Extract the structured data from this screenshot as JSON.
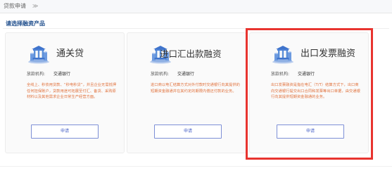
{
  "breadcrumb": {
    "current": "贷款申请",
    "separator": "≫"
  },
  "section": {
    "title": "请选择融资产品"
  },
  "products": [
    {
      "title": "通关贷",
      "org_label": "放款机构:",
      "org_value": "交通银行",
      "description": "全线上、秒债用贷款、“秒电秒贷”，并且企业无需抵押任何担保账户，贷款用途可拓展至付汇、备货、采购原材料以及其他需求企业日常生产经营方面。",
      "apply_label": "申请"
    },
    {
      "title": "进口汇出款融资",
      "org_label": "放款机构:",
      "org_value": "交通银行",
      "description": "进口商以电汇结算方式对外付款时交通银行向其提供的短期资金融通并在其约定的期限内偿还付款的业务。",
      "apply_label": "申请"
    },
    {
      "title": "出口发票融资",
      "org_label": "放款机构:",
      "org_value": "交通银行",
      "description": "出口发票融资是指在电汇（T/T）结算方式下，出口商向交通银行提交出口合同和发票等出口单据，由交通银行向其提供短期资金融通的业务。",
      "apply_label": "申请"
    }
  ],
  "colors": {
    "accent": "#4a63c8",
    "description": "#e0703a",
    "section_title": "#1f4e8c",
    "highlight": "#e8342f",
    "icon_blue": "#5b8fd8"
  },
  "icons": {
    "product": "bank-coin-icon"
  }
}
